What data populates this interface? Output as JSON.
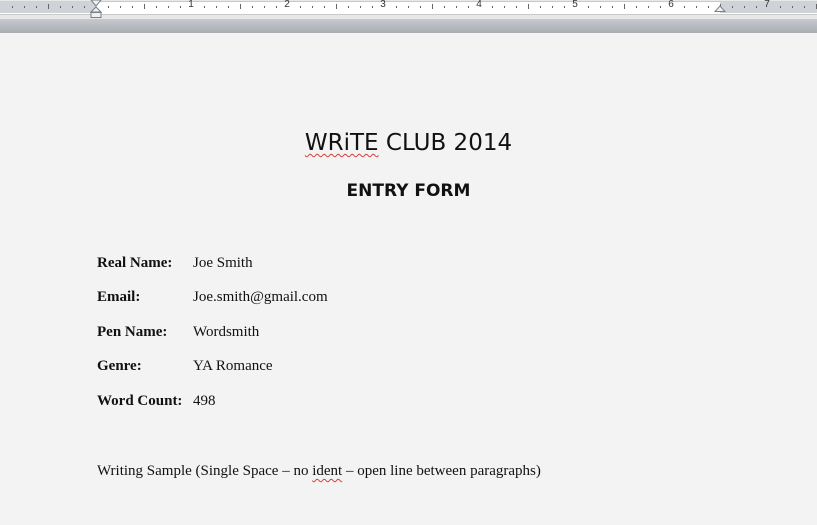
{
  "ruler": {
    "numbers": [
      "1",
      "2",
      "3",
      "4",
      "5",
      "6",
      "7"
    ]
  },
  "document": {
    "title_part1": "WRiTE",
    "title_part2": " CLUB 2014",
    "subtitle": "ENTRY FORM",
    "fields": [
      {
        "label": "Real Name:",
        "value": "Joe Smith"
      },
      {
        "label": "Email:",
        "value": "Joe.smith@gmail.com"
      },
      {
        "label": "Pen Name:",
        "value": "Wordsmith"
      },
      {
        "label": "Genre:",
        "value": "YA Romance"
      },
      {
        "label": "Word Count:",
        "value": "498"
      }
    ],
    "writing_sample": {
      "before": "Writing Sample (Single Space – no ",
      "misspelled": "ident",
      "after": " – open line between paragraphs)"
    }
  },
  "colors": {
    "spellcheck_underline": "#d43c3c",
    "page_background": "#f3f3f3"
  }
}
